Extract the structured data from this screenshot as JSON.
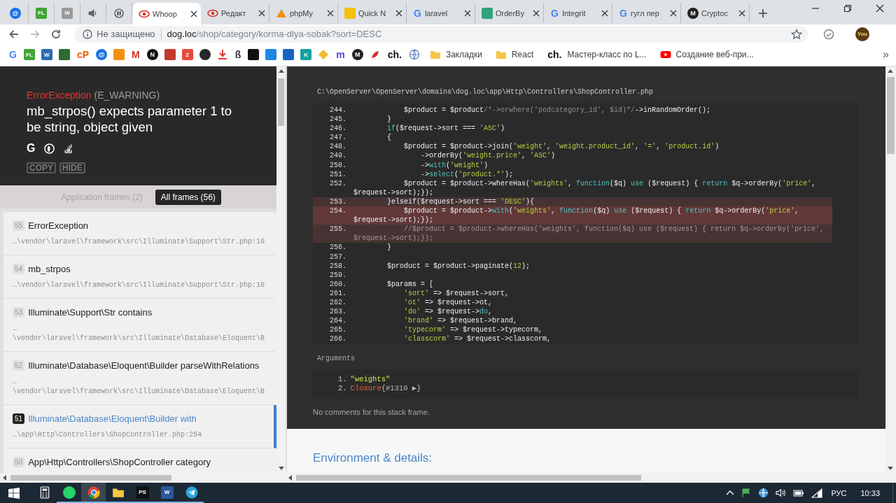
{
  "tabs": [
    {
      "pinned": true,
      "selected": false,
      "icon": {
        "kind": "circle",
        "color": "#1a73e8",
        "glyph": "@"
      }
    },
    {
      "pinned": true,
      "selected": false,
      "icon": {
        "kind": "square",
        "color": "#3fa535",
        "glyph": "FL"
      }
    },
    {
      "pinned": true,
      "selected": false,
      "icon": {
        "kind": "square",
        "color": "#9a9a9a",
        "glyph": "W"
      }
    },
    {
      "pinned": true,
      "selected": false,
      "icon": {
        "kind": "speaker",
        "color": "#5f6368"
      }
    },
    {
      "pinned": true,
      "selected": false,
      "icon": {
        "kind": "pause",
        "color": "#3c4043"
      }
    },
    {
      "pinned": false,
      "selected": true,
      "title": "Whoop",
      "icon": {
        "kind": "eye",
        "color": "#d93025"
      }
    },
    {
      "pinned": false,
      "selected": false,
      "title": "Редакт",
      "icon": {
        "kind": "eye",
        "color": "#d93025"
      }
    },
    {
      "pinned": false,
      "selected": false,
      "title": "phpMy",
      "icon": {
        "kind": "tri",
        "color": "#f29111"
      }
    },
    {
      "pinned": false,
      "selected": false,
      "title": "Quick N",
      "icon": {
        "kind": "square",
        "color": "#f4c20d"
      }
    },
    {
      "pinned": false,
      "selected": false,
      "title": "laravel",
      "icon": {
        "kind": "letter",
        "color": "#4285f4",
        "glyph": "G"
      }
    },
    {
      "pinned": false,
      "selected": false,
      "title": "OrderBy",
      "icon": {
        "kind": "square",
        "color": "#2fa37a"
      }
    },
    {
      "pinned": false,
      "selected": false,
      "title": "Integrit",
      "icon": {
        "kind": "letter",
        "color": "#4285f4",
        "glyph": "G"
      }
    },
    {
      "pinned": false,
      "selected": false,
      "title": "гугл пер",
      "icon": {
        "kind": "letter",
        "color": "#4285f4",
        "glyph": "G"
      }
    },
    {
      "pinned": false,
      "selected": false,
      "title": "Cryptoc",
      "icon": {
        "kind": "circle",
        "color": "#222222",
        "glyph": "M"
      }
    }
  ],
  "address": {
    "security": "Не защищено",
    "host": "dog.loc",
    "path": "/shop/category/korma-dlya-sobak?sort=DESC"
  },
  "profile": {
    "initials": "You"
  },
  "bookmarks": [
    {
      "icon": {
        "kind": "letter",
        "color": "#4285f4",
        "glyph": "G"
      }
    },
    {
      "icon": {
        "kind": "square",
        "color": "#3fa535",
        "glyph": "FL"
      }
    },
    {
      "icon": {
        "kind": "square",
        "color": "#2b6cb0",
        "glyph": "W"
      }
    },
    {
      "icon": {
        "kind": "square",
        "color": "#2e6b2e"
      }
    },
    {
      "icon": {
        "kind": "letter",
        "color": "#f25c05",
        "glyph": "cP"
      }
    },
    {
      "icon": {
        "kind": "circle",
        "color": "#1a73e8",
        "glyph": "@"
      }
    },
    {
      "icon": {
        "kind": "square",
        "color": "#f29111"
      }
    },
    {
      "icon": {
        "kind": "letter",
        "color": "#d93025",
        "glyph": "M"
      }
    },
    {
      "icon": {
        "kind": "circle",
        "color": "#111111",
        "glyph": "N"
      }
    },
    {
      "icon": {
        "kind": "square",
        "color": "#c0392b"
      }
    },
    {
      "icon": {
        "kind": "square",
        "color": "#e74c3c",
        "glyph": "Z"
      }
    },
    {
      "icon": {
        "kind": "circle",
        "color": "#24292e"
      }
    },
    {
      "icon": {
        "kind": "download",
        "color": "#e53935"
      }
    },
    {
      "icon": {
        "kind": "letter",
        "color": "#333333",
        "glyph": "ß"
      }
    },
    {
      "icon": {
        "kind": "square",
        "color": "#111111"
      }
    },
    {
      "icon": {
        "kind": "square",
        "color": "#1e88e5"
      }
    },
    {
      "icon": {
        "kind": "square",
        "color": "#1565c0"
      }
    },
    {
      "icon": {
        "kind": "square",
        "color": "#16a0a0",
        "glyph": "K"
      }
    },
    {
      "icon": {
        "kind": "diamond",
        "color": "#f3ba2f"
      }
    },
    {
      "icon": {
        "kind": "letter",
        "color": "#5a3fd6",
        "glyph": "m"
      }
    },
    {
      "icon": {
        "kind": "circle",
        "color": "#222222",
        "glyph": "M"
      }
    },
    {
      "icon": {
        "kind": "pepper",
        "color": "#d32f2f"
      }
    },
    {
      "icon": {
        "kind": "letter",
        "color": "#111111",
        "glyph": "ch."
      }
    },
    {
      "icon": {
        "kind": "globe",
        "color": "#5b7dbd"
      }
    },
    {
      "label": "Закладки",
      "icon": {
        "kind": "folder",
        "color": "#f6c644"
      }
    },
    {
      "label": "React",
      "icon": {
        "kind": "folder",
        "color": "#f6c644"
      }
    },
    {
      "label": "Мастер-класс по L...",
      "icon": {
        "kind": "letter",
        "color": "#111111",
        "glyph": "ch."
      }
    },
    {
      "label": "Создание веб-при...",
      "icon": {
        "kind": "play",
        "color": "#ff0000"
      }
    }
  ],
  "more_bookmarks": "»",
  "error": {
    "class": "ErrorException",
    "type": "(E_WARNING)",
    "message": "mb_strpos() expects parameter 1 to be string, object given",
    "search_icons": [
      {
        "kind": "letter",
        "glyph": "G"
      },
      {
        "kind": "duck"
      },
      {
        "kind": "stack"
      }
    ],
    "buttons": [
      "COPY",
      "HIDE"
    ]
  },
  "frame_tabs": [
    {
      "label": "Application frames (2)",
      "selected": false
    },
    {
      "label": "All frames (56)",
      "selected": true
    }
  ],
  "frames": [
    {
      "number": "55",
      "title": "ErrorException",
      "path": [
        "…\\vendor\\laravel\\framework\\src\\Illuminate\\Support\\Str.php:10"
      ],
      "selected": false
    },
    {
      "number": "54",
      "title": "mb_strpos",
      "path": [
        "…\\vendor\\laravel\\framework\\src\\Illuminate\\Support\\Str.php:10"
      ],
      "selected": false
    },
    {
      "number": "53",
      "title": "Illuminate\\Support\\Str contains",
      "path": [
        "…",
        "\\vendor\\laravel\\framework\\src\\Illuminate\\Database\\Eloquent\\B"
      ],
      "selected": false
    },
    {
      "number": "52",
      "title": "Illuminate\\Database\\Eloquent\\Builder parseWithRelations",
      "path": [
        "…",
        "\\vendor\\laravel\\framework\\src\\Illuminate\\Database\\Eloquent\\B"
      ],
      "selected": false
    },
    {
      "number": "51",
      "title": "Illuminate\\Database\\Eloquent\\Builder with",
      "path": [
        "…\\app\\Http\\Controllers\\ShopController.php:254"
      ],
      "selected": true
    },
    {
      "number": "50",
      "title": "App\\Http\\Controllers\\ShopController category",
      "selected": false
    }
  ],
  "file_path": "C:\\OpenServer\\OpenServer\\domains\\dog.loc\\app\\Http\\Controllers\\ShopController.php",
  "code": [
    {
      "number": "244.",
      "code": "            $product = $product/*->orwhere('podcategory_id', $id)*/->inRandomOrder();",
      "highlighted": false,
      "selected": false
    },
    {
      "number": "245.",
      "code": "        }",
      "highlighted": false,
      "selected": false
    },
    {
      "number": "246.",
      "code": "        if($request->sort === 'ASC')",
      "highlighted": false,
      "selected": false
    },
    {
      "number": "247.",
      "code": "        {",
      "highlighted": false,
      "selected": false
    },
    {
      "number": "248.",
      "code": "            $product = $product->join('weight', 'weight.product_id', '=', 'product.id')",
      "highlighted": false,
      "selected": false
    },
    {
      "number": "249.",
      "code": "                ->orderBy('weight.price', 'ASC')",
      "highlighted": false,
      "selected": false
    },
    {
      "number": "250.",
      "code": "                ->with('weight')",
      "highlighted": false,
      "selected": false
    },
    {
      "number": "251.",
      "code": "                ->select('product.*');",
      "highlighted": false,
      "selected": false
    },
    {
      "number": "252.",
      "code": "            $product = $product->whereHas('weights', function($q) use ($request) { return $q->orderBy('price', $request->sort);});",
      "highlighted": false,
      "selected": false
    },
    {
      "number": "253.",
      "code": "        }elseif($request->sort === 'DESC'){",
      "highlighted": true,
      "selected": false
    },
    {
      "number": "254.",
      "code": "            $product = $product->with('weights', function($q) use ($request) { return $q->orderBy('price', $request->sort);});",
      "highlighted": true,
      "selected": true
    },
    {
      "number": "255.",
      "code": "            //$product = $product->whereHas('weights', function($q) use ($request) { return $q->orderBy('price', $request->sort);});",
      "highlighted": true,
      "selected": false
    },
    {
      "number": "256.",
      "code": "        }",
      "highlighted": false,
      "selected": false
    },
    {
      "number": "257.",
      "highlighted": false,
      "selected": false
    },
    {
      "number": "258.",
      "code": "        $product = $product->paginate(12);",
      "highlighted": false,
      "selected": false
    },
    {
      "number": "259.",
      "highlighted": false,
      "selected": false
    },
    {
      "number": "260.",
      "code": "        $params = [",
      "highlighted": false,
      "selected": false
    },
    {
      "number": "261.",
      "code": "            'sort' => $request->sort,",
      "highlighted": false,
      "selected": false
    },
    {
      "number": "262.",
      "code": "            'ot' => $request->ot,",
      "highlighted": false,
      "selected": false
    },
    {
      "number": "263.",
      "code": "            'do' => $request->do,",
      "highlighted": false,
      "selected": false
    },
    {
      "number": "264.",
      "code": "            'brand' => $request->brand,",
      "highlighted": false,
      "selected": false
    },
    {
      "number": "265.",
      "code": "            'typecorm' => $request->typecorm,",
      "highlighted": false,
      "selected": false
    },
    {
      "number": "266.",
      "code": "            'classcorm' => $request->classcorm,",
      "highlighted": false,
      "selected": false
    }
  ],
  "arguments": {
    "title": "Arguments",
    "items": [
      {
        "number": "1.",
        "kind": "string",
        "value": "\"weights\""
      },
      {
        "number": "2.",
        "kind": "object",
        "value": "Closure",
        "detail": "{#1310 ▶}"
      }
    ]
  },
  "comments": "No comments for this stack frame.",
  "section_heading": "Environment & details:",
  "taskbar": {
    "apps": [
      {
        "icon": {
          "kind": "calc",
          "color": "#dddddd"
        },
        "running": false,
        "selected": false
      },
      {
        "icon": {
          "kind": "circle",
          "color": "#25d366"
        },
        "running": true,
        "selected": false
      },
      {
        "icon": {
          "kind": "chrome",
          "color": "#db4437"
        },
        "running": true,
        "selected": true
      },
      {
        "icon": {
          "kind": "folder",
          "color": "#f6c644"
        },
        "running": true,
        "selected": false
      },
      {
        "icon": {
          "kind": "square",
          "color": "#111111",
          "glyph": "PS"
        },
        "running": true,
        "selected": false
      },
      {
        "icon": {
          "kind": "square",
          "color": "#2b579a",
          "glyph": "W"
        },
        "running": true,
        "selected": false
      },
      {
        "icon": {
          "kind": "plane",
          "color": "#2aa3df"
        },
        "running": true,
        "selected": false
      }
    ],
    "language": "РУС",
    "time": "10:33"
  }
}
